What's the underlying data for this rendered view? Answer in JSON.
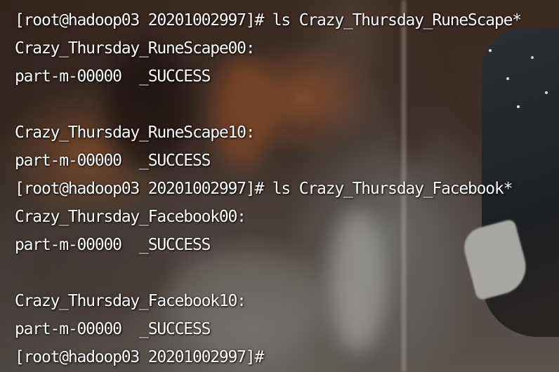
{
  "terminal": {
    "lines": [
      "[root@hadoop03 20201002997]# ls Crazy_Thursday_RuneScape*",
      "Crazy_Thursday_RuneScape00:",
      "part-m-00000  _SUCCESS",
      "",
      "Crazy_Thursday_RuneScape10:",
      "part-m-00000  _SUCCESS",
      "[root@hadoop03 20201002997]# ls Crazy_Thursday_Facebook*",
      "Crazy_Thursday_Facebook00:",
      "part-m-00000  _SUCCESS",
      "",
      "Crazy_Thursday_Facebook10:",
      "part-m-00000  _SUCCESS",
      "[root@hadoop03 20201002997]#"
    ],
    "text_color": "#ffffff"
  }
}
